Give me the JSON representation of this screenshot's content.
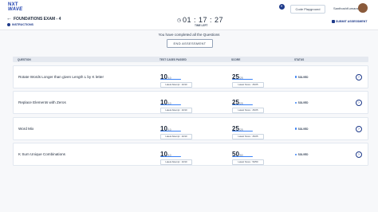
{
  "header": {
    "logo_line1": "NXT",
    "logo_line2": "WAVE",
    "code_playground": "Code Playground",
    "username": "SanthoshKumarawal"
  },
  "exam": {
    "title": "FOUNDATIONS EXAM - 4",
    "instructions": "INSTRUCTIONS",
    "timer": "01 : 17 : 27",
    "time_left": "TIME LEFT",
    "submit_label": "SUBMIT ASSESSMENT"
  },
  "summary": {
    "completed_text": "You have completed all the Questions",
    "end_button": "END ASSESSMENT"
  },
  "table": {
    "headers": [
      "QUESTION",
      "TEST CASES PASSED",
      "SCORE",
      "STATUS"
    ],
    "rows": [
      {
        "question": "Rotate Words Longer than given Length L by K letter",
        "tc": "10",
        "tc_total": "10",
        "tc_latest": "Latest Attempt : 10/10",
        "score": "25",
        "score_total": "25",
        "score_latest": "Latest Score : 25/25",
        "status": "SOLVED"
      },
      {
        "question": "Replace Elements with Zeros",
        "tc": "10",
        "tc_total": "10",
        "tc_latest": "Latest Attempt : 10/10",
        "score": "25",
        "score_total": "25",
        "score_latest": "Latest Score : 25/25",
        "status": "SOLVED"
      },
      {
        "question": "Word Mix",
        "tc": "10",
        "tc_total": "10",
        "tc_latest": "Latest Attempt : 10/10",
        "score": "25",
        "score_total": "25",
        "score_latest": "Latest Score : 25/25",
        "status": "SOLVED"
      },
      {
        "question": "K Sum Unique Combinations",
        "tc": "10",
        "tc_total": "10",
        "tc_latest": "Latest Attempt : 10/10",
        "score": "50",
        "score_total": "50",
        "score_latest": "Latest Score : 50/50",
        "status": "SOLVED"
      }
    ]
  },
  "colors": {
    "accent": "#1e3a8a",
    "bar": "#3b82f6"
  }
}
